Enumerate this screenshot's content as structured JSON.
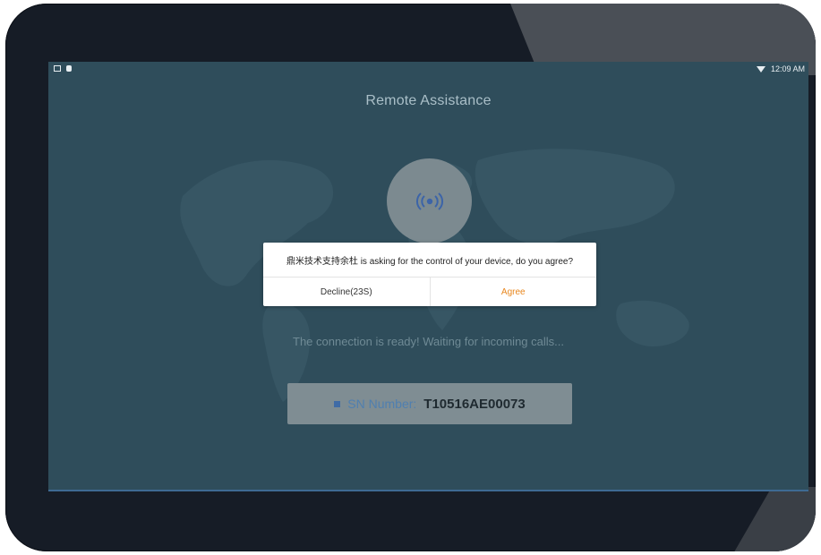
{
  "status_bar": {
    "left_icons": [
      "sd-card-icon",
      "notification-dot-icon"
    ],
    "wifi_icon": "wifi-icon",
    "time": "12:09 AM"
  },
  "app": {
    "title": "Remote Assistance",
    "broadcast_icon": "broadcast-icon",
    "ready_message": "The connection is ready! Waiting for incoming calls...",
    "sn_label": "SN Number:",
    "sn_value": "T10516AE00073"
  },
  "dialog": {
    "message": "鼎米技术支持余杜 is asking for the control of your device, do you agree?",
    "decline_label": "Decline(23S)",
    "agree_label": "Agree"
  },
  "colors": {
    "screen_bg": "#2f4d5b",
    "accent_orange": "#e8871e",
    "sn_label_blue": "#4f7fb0"
  }
}
